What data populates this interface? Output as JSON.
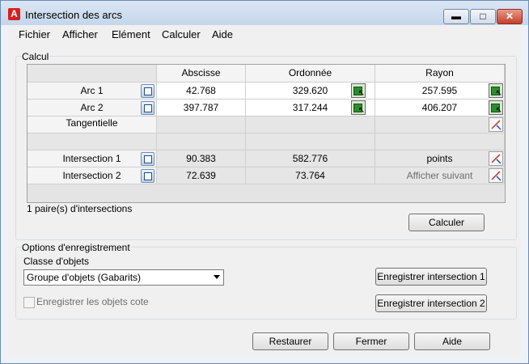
{
  "window": {
    "title": "Intersection des arcs",
    "app_icon_letter": "A"
  },
  "controls": {
    "minimize": "▬",
    "maximize": "□",
    "close": "✕"
  },
  "menu": [
    "Fichier",
    "Afficher",
    "Elément",
    "Calculer",
    "Aide"
  ],
  "calc_group": {
    "legend": "Calcul"
  },
  "columns": [
    "Abscisse",
    "Ordonnée",
    "Rayon"
  ],
  "rows": {
    "arc1": {
      "label": "Arc 1",
      "x": "42.768",
      "y": "329.620",
      "r": "257.595"
    },
    "arc2": {
      "label": "Arc 2",
      "x": "397.787",
      "y": "317.244",
      "r": "406.207"
    },
    "tangent": {
      "label": "Tangentielle"
    },
    "int1": {
      "label": "Intersection 1",
      "x": "90.383",
      "y": "582.776",
      "r": "points"
    },
    "int2": {
      "label": "Intersection 2",
      "x": "72.639",
      "y": "73.764",
      "r": "Afficher suivant"
    }
  },
  "pairs_text": "1 paire(s) d'intersections",
  "calculate_button": "Calculer",
  "save_group": {
    "legend": "Options d'enregistrement",
    "class_label": "Classe d'objets",
    "class_value": "Groupe d'objets (Gabarits)",
    "checkbox_label": "Enregistrer les objets cote",
    "save_int1": "Enregistrer intersection 1",
    "save_int2": "Enregistrer intersection 2"
  },
  "footer": {
    "restore": "Restaurer",
    "close": "Fermer",
    "help": "Aide"
  }
}
